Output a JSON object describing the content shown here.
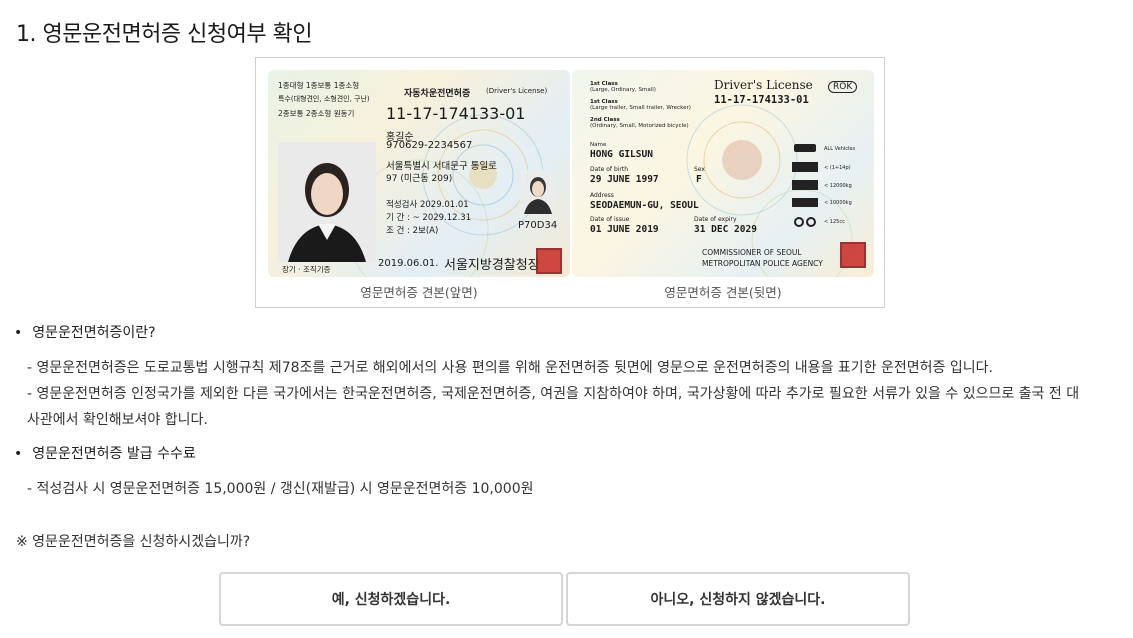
{
  "title": "1. 영문운전면허증 신청여부 확인",
  "front_card": {
    "class_line1": "1종대형  1종보통  1종소형",
    "class_line2": "특수(대형견인, 소형견인, 구난)",
    "class_line3": "2종보통  2종소형  원동기",
    "header_kr": "자동차운전면허증",
    "header_en": "(Driver's License)",
    "license_no": "11-17-174133-01",
    "name": "홍길순",
    "id_no": "970629-2234567",
    "address1": "서울특별시 서대문구 통일로",
    "address2": "97 (미근동 209)",
    "aptitude": "적성검사    2029.01.01",
    "period": "기    간 : ~ 2029.12.31",
    "condition": "조    건 : 2보(A)",
    "serial": "P70D34",
    "organ": "장기 · 조직기증",
    "issue_date": "2019.06.01.",
    "issuer": "서울지방경찰청장",
    "caption": "영문면허증 견본(앞면)"
  },
  "back_card": {
    "class1_title": "1st Class",
    "class1_desc": "(Large, Ordinary, Small)",
    "class1b_title": "1st Class",
    "class1b_desc": "(Large trailer, Small trailer, Wrecker)",
    "class2_title": "2nd Class",
    "class2_desc": "(Ordinary, Small, Motorized bicycle)",
    "header": "Driver's License",
    "country": "ROK",
    "license_no": "11-17-174133-01",
    "name_label": "Name",
    "name": "HONG GILSUN",
    "dob_label": "Date of birth",
    "dob": "29 JUNE 1997",
    "sex_label": "Sex",
    "sex": "F",
    "address_label": "Address",
    "address": "SEODAEMUN-GU, SEOUL",
    "issue_label": "Date of issue",
    "issue": "01 JUNE 2019",
    "expiry_label": "Date of expiry",
    "expiry": "31 DEC 2029",
    "commissioner1": "COMMISSIONER OF SEOUL",
    "commissioner2": "METROPOLITAN POLICE AGENCY",
    "vehicles": [
      "ALL Vehicles",
      "< (1+14p)",
      "< 12000kg",
      "< 10000kg",
      "< 125cc"
    ],
    "caption": "영문면허증 견본(뒷면)"
  },
  "section1": {
    "heading": "영문운전면허증이란?",
    "line1": "- 영문운전면허증은 도로교통법 시행규칙 제78조를 근거로 해외에서의 사용 편의를 위해 운전면허증 뒷면에 영문으로 운전면허증의 내용을 표기한 운전면허증 입니다.",
    "line2": "- 영문운전면허증 인정국가를 제외한 다른 국가에서는 한국운전면허증, 국제운전면허증, 여권을 지참하여야 하며, 국가상황에 따라 추가로 필요한 서류가 있을 수 있으므로 출국 전 대",
    "line3": "사관에서 확인해보셔야 합니다."
  },
  "section2": {
    "heading": "영문운전면허증 발급 수수료",
    "line1": "- 적성검사 시 영문운전면허증 15,000원 / 갱신(재발급) 시 영문운전면허증 10,000원"
  },
  "notice": "※ 영문운전면허증을 신청하시겠습니까?",
  "buttons": {
    "yes": "예, 신청하겠습니다.",
    "no": "아니오, 신청하지 않겠습니다."
  }
}
